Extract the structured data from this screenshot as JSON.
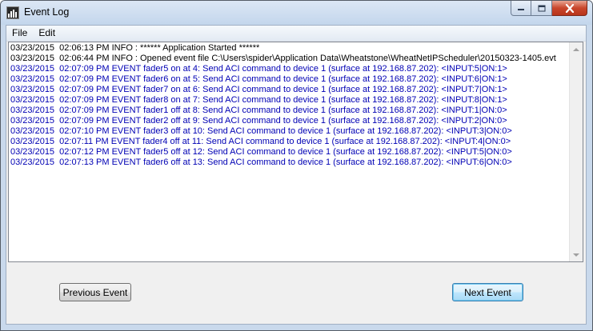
{
  "window": {
    "title": "Event Log"
  },
  "menu": {
    "items": [
      {
        "label": "File"
      },
      {
        "label": "Edit"
      }
    ]
  },
  "log": {
    "lines": [
      {
        "type": "info",
        "text": "03/23/2015  02:06:13 PM INFO : ****** Application Started ******"
      },
      {
        "type": "info",
        "text": "03/23/2015  02:06:44 PM INFO : Opened event file C:\\Users\\spider\\Application Data\\Wheatstone\\WheatNetIPScheduler\\20150323-1405.evt"
      },
      {
        "type": "event",
        "text": "03/23/2015  02:07:09 PM EVENT fader5 on at 4: Send ACI command to device 1 (surface at 192.168.87.202): <INPUT:5|ON:1>"
      },
      {
        "type": "event",
        "text": "03/23/2015  02:07:09 PM EVENT fader6 on at 5: Send ACI command to device 1 (surface at 192.168.87.202): <INPUT:6|ON:1>"
      },
      {
        "type": "event",
        "text": "03/23/2015  02:07:09 PM EVENT fader7 on at 6: Send ACI command to device 1 (surface at 192.168.87.202): <INPUT:7|ON:1>"
      },
      {
        "type": "event",
        "text": "03/23/2015  02:07:09 PM EVENT fader8 on at 7: Send ACI command to device 1 (surface at 192.168.87.202): <INPUT:8|ON:1>"
      },
      {
        "type": "event",
        "text": "03/23/2015  02:07:09 PM EVENT fader1 off at 8: Send ACI command to device 1 (surface at 192.168.87.202): <INPUT:1|ON:0>"
      },
      {
        "type": "event",
        "text": "03/23/2015  02:07:09 PM EVENT fader2 off at 9: Send ACI command to device 1 (surface at 192.168.87.202): <INPUT:2|ON:0>"
      },
      {
        "type": "event",
        "text": "03/23/2015  02:07:10 PM EVENT fader3 off at 10: Send ACI command to device 1 (surface at 192.168.87.202): <INPUT:3|ON:0>"
      },
      {
        "type": "event",
        "text": "03/23/2015  02:07:11 PM EVENT fader4 off at 11: Send ACI command to device 1 (surface at 192.168.87.202): <INPUT:4|ON:0>"
      },
      {
        "type": "event",
        "text": "03/23/2015  02:07:12 PM EVENT fader5 off at 12: Send ACI command to device 1 (surface at 192.168.87.202): <INPUT:5|ON:0>"
      },
      {
        "type": "event",
        "text": "03/23/2015  02:07:13 PM EVENT fader6 off at 13: Send ACI command to device 1 (surface at 192.168.87.202): <INPUT:6|ON:0>"
      }
    ]
  },
  "buttons": {
    "previous_label": "Previous Event",
    "next_label": "Next Event"
  },
  "colors": {
    "info_text": "#000000",
    "event_text": "#0000b4",
    "close_button": "#c9462c",
    "default_button_border": "#3c7fb1"
  },
  "icons": {
    "app": "wheatstone-meter-icon",
    "minimize": "minimize-icon",
    "maximize": "maximize-icon",
    "close": "close-icon",
    "scroll_up": "scroll-up-arrow-icon",
    "scroll_down": "scroll-down-arrow-icon"
  }
}
